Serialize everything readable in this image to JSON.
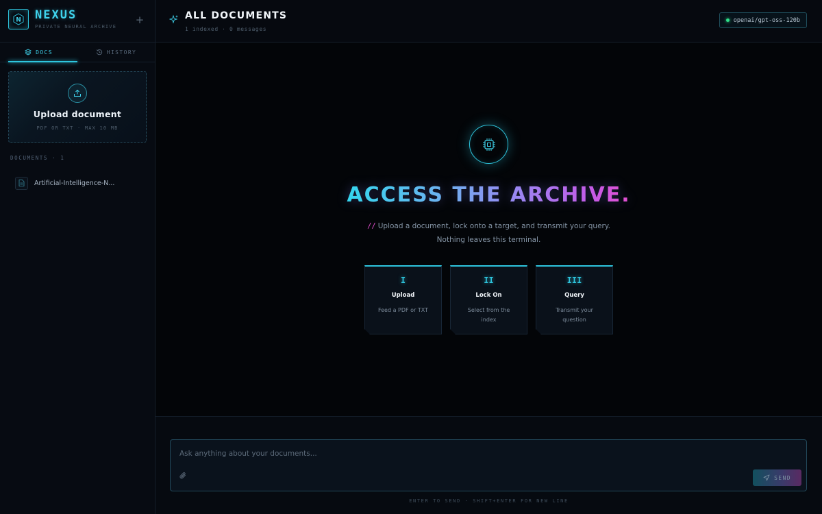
{
  "brand": {
    "name": "NEXUS",
    "subtitle": "PRIVATE NEURAL ARCHIVE",
    "logo_letter": "N"
  },
  "sidebar": {
    "new_label": "+",
    "tabs": [
      {
        "label": "DOCS",
        "icon": "layers-icon",
        "active": true
      },
      {
        "label": "HISTORY",
        "icon": "history-icon",
        "active": false
      }
    ],
    "upload": {
      "title": "Upload document",
      "subtitle": "PDF OR TXT · MAX 10 MB",
      "icon": "upload-icon"
    },
    "documents_label": "DOCUMENTS · 1",
    "documents": [
      {
        "name": "Artificial-Intelligence-N...",
        "icon": "file-icon"
      }
    ]
  },
  "header": {
    "title": "ALL DOCUMENTS",
    "meta": "1 indexed · 0 messages",
    "model": "openai/gpt-oss-120b",
    "model_status_color": "#2fe08a"
  },
  "hero": {
    "icon": "chip-icon",
    "title": "ACCESS THE ARCHIVE.",
    "subtitle_prefix": "//",
    "subtitle_line1": "Upload a document, lock onto a target, and transmit your query.",
    "subtitle_line2": "Nothing leaves this terminal.",
    "steps": [
      {
        "num": "I",
        "title": "Upload",
        "desc": "Feed a PDF or TXT"
      },
      {
        "num": "II",
        "title": "Lock On",
        "desc": "Select from the index"
      },
      {
        "num": "III",
        "title": "Query",
        "desc": "Transmit your question"
      }
    ]
  },
  "composer": {
    "placeholder": "Ask anything about your documents...",
    "send_label": "SEND",
    "hint": "ENTER TO SEND · SHIFT+ENTER FOR NEW LINE"
  },
  "colors": {
    "accent": "#2ec5de",
    "magenta": "#e44fd0",
    "background": "#030508"
  }
}
